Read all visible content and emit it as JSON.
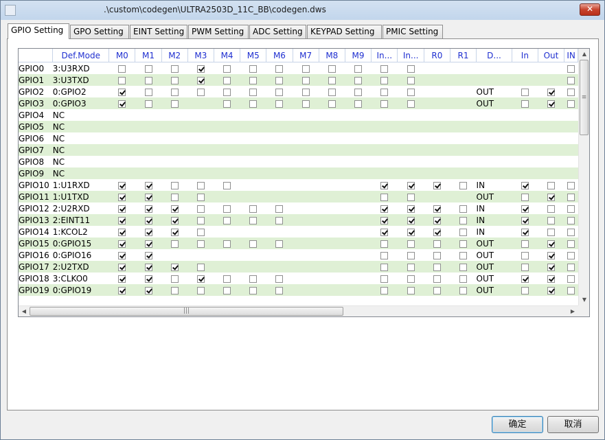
{
  "window": {
    "title": ".\\custom\\codegen\\ULTRA2503D_11C_BB\\codegen.dws",
    "close_glyph": "✕"
  },
  "tabs": [
    {
      "label": "GPIO Setting",
      "active": true
    },
    {
      "label": "GPO Setting"
    },
    {
      "label": "EINT Setting"
    },
    {
      "label": "PWM Setting"
    },
    {
      "label": "ADC Setting"
    },
    {
      "label": "KEYPAD Setting"
    },
    {
      "label": "PMIC Setting"
    }
  ],
  "grid": {
    "columns": [
      "",
      "Def.Mode",
      "M0",
      "M1",
      "M2",
      "M3",
      "M4",
      "M5",
      "M6",
      "M7",
      "M8",
      "M9",
      "In...",
      "In...",
      "R0",
      "R1",
      "D...",
      "In",
      "Out",
      "IN"
    ],
    "rows": [
      {
        "name": "GPIO0",
        "mode": "3:U3RXD",
        "m": [
          0,
          0,
          0,
          1,
          0,
          0,
          0,
          0,
          0,
          0
        ],
        "in1": 0,
        "in2": 0,
        "r0": null,
        "r1": null,
        "dir": "",
        "inv": null,
        "out": null,
        "ink": 0
      },
      {
        "name": "GPIO1",
        "mode": "3:U3TXD",
        "m": [
          0,
          0,
          0,
          1,
          0,
          0,
          0,
          0,
          0,
          0
        ],
        "in1": 0,
        "in2": 0,
        "r0": null,
        "r1": null,
        "dir": "",
        "inv": null,
        "out": null,
        "ink": 0
      },
      {
        "name": "GPIO2",
        "mode": "0:GPIO2",
        "m": [
          1,
          0,
          0,
          0,
          0,
          0,
          0,
          0,
          0,
          0
        ],
        "in1": 0,
        "in2": 0,
        "r0": null,
        "r1": null,
        "dir": "OUT",
        "inv": 0,
        "out": 1,
        "ink": 0
      },
      {
        "name": "GPIO3",
        "mode": "0:GPIO3",
        "m": [
          1,
          0,
          0,
          null,
          0,
          0,
          0,
          0,
          0,
          0
        ],
        "in1": 0,
        "in2": 0,
        "r0": null,
        "r1": null,
        "dir": "OUT",
        "inv": 0,
        "out": 1,
        "ink": 0
      },
      {
        "name": "GPIO4",
        "mode": "NC",
        "m": [
          null,
          null,
          null,
          null,
          null,
          null,
          null,
          null,
          null,
          null
        ],
        "in1": null,
        "in2": null,
        "r0": null,
        "r1": null,
        "dir": "",
        "inv": null,
        "out": null,
        "ink": null
      },
      {
        "name": "GPIO5",
        "mode": "NC",
        "m": [
          null,
          null,
          null,
          null,
          null,
          null,
          null,
          null,
          null,
          null
        ],
        "in1": null,
        "in2": null,
        "r0": null,
        "r1": null,
        "dir": "",
        "inv": null,
        "out": null,
        "ink": null
      },
      {
        "name": "GPIO6",
        "mode": "NC",
        "m": [
          null,
          null,
          null,
          null,
          null,
          null,
          null,
          null,
          null,
          null
        ],
        "in1": null,
        "in2": null,
        "r0": null,
        "r1": null,
        "dir": "",
        "inv": null,
        "out": null,
        "ink": null
      },
      {
        "name": "GPIO7",
        "mode": "NC",
        "m": [
          null,
          null,
          null,
          null,
          null,
          null,
          null,
          null,
          null,
          null
        ],
        "in1": null,
        "in2": null,
        "r0": null,
        "r1": null,
        "dir": "",
        "inv": null,
        "out": null,
        "ink": null
      },
      {
        "name": "GPIO8",
        "mode": "NC",
        "m": [
          null,
          null,
          null,
          null,
          null,
          null,
          null,
          null,
          null,
          null
        ],
        "in1": null,
        "in2": null,
        "r0": null,
        "r1": null,
        "dir": "",
        "inv": null,
        "out": null,
        "ink": null
      },
      {
        "name": "GPIO9",
        "mode": "NC",
        "m": [
          null,
          null,
          null,
          null,
          null,
          null,
          null,
          null,
          null,
          null
        ],
        "in1": null,
        "in2": null,
        "r0": null,
        "r1": null,
        "dir": "",
        "inv": null,
        "out": null,
        "ink": null
      },
      {
        "name": "GPIO10",
        "mode": "1:U1RXD",
        "m": [
          1,
          1,
          0,
          0,
          0,
          null,
          null,
          null,
          null,
          null
        ],
        "in1": 1,
        "in2": 1,
        "r0": 1,
        "r1": 0,
        "dir": "IN",
        "inv": 1,
        "out": 0,
        "ink": 0
      },
      {
        "name": "GPIO11",
        "mode": "1:U1TXD",
        "m": [
          1,
          1,
          0,
          0,
          null,
          null,
          null,
          null,
          null,
          null
        ],
        "in1": 0,
        "in2": 0,
        "r0": null,
        "r1": null,
        "dir": "OUT",
        "inv": 0,
        "out": 1,
        "ink": 0
      },
      {
        "name": "GPIO12",
        "mode": "2:U2RXD",
        "m": [
          1,
          1,
          1,
          0,
          0,
          0,
          0,
          null,
          null,
          null
        ],
        "in1": 1,
        "in2": 1,
        "r0": 1,
        "r1": 0,
        "dir": "IN",
        "inv": 1,
        "out": 0,
        "ink": 0
      },
      {
        "name": "GPIO13",
        "mode": "2:EINT11",
        "m": [
          1,
          1,
          1,
          0,
          0,
          0,
          0,
          null,
          null,
          null
        ],
        "in1": 1,
        "in2": 1,
        "r0": 1,
        "r1": 0,
        "dir": "IN",
        "inv": 1,
        "out": 0,
        "ink": 0
      },
      {
        "name": "GPIO14",
        "mode": "1:KCOL2",
        "m": [
          1,
          1,
          1,
          0,
          null,
          null,
          null,
          null,
          null,
          null
        ],
        "in1": 1,
        "in2": 1,
        "r0": 1,
        "r1": 0,
        "dir": "IN",
        "inv": 1,
        "out": 0,
        "ink": 0
      },
      {
        "name": "GPIO15",
        "mode": "0:GPIO15",
        "m": [
          1,
          1,
          0,
          0,
          0,
          0,
          0,
          null,
          null,
          null
        ],
        "in1": 0,
        "in2": 0,
        "r0": 0,
        "r1": 0,
        "dir": "OUT",
        "inv": 0,
        "out": 1,
        "ink": 0
      },
      {
        "name": "GPIO16",
        "mode": "0:GPIO16",
        "m": [
          1,
          1,
          null,
          null,
          null,
          null,
          null,
          null,
          null,
          null
        ],
        "in1": 0,
        "in2": 0,
        "r0": 0,
        "r1": 0,
        "dir": "OUT",
        "inv": 0,
        "out": 1,
        "ink": 0
      },
      {
        "name": "GPIO17",
        "mode": "2:U2TXD",
        "m": [
          1,
          1,
          1,
          0,
          null,
          null,
          null,
          null,
          null,
          null
        ],
        "in1": 0,
        "in2": 0,
        "r0": 0,
        "r1": 0,
        "dir": "OUT",
        "inv": 0,
        "out": 1,
        "ink": 0
      },
      {
        "name": "GPIO18",
        "mode": "3:CLKO0",
        "m": [
          1,
          1,
          0,
          1,
          0,
          0,
          0,
          null,
          null,
          null
        ],
        "in1": 0,
        "in2": 0,
        "r0": 0,
        "r1": 0,
        "dir": "OUT",
        "inv": 1,
        "out": 1,
        "ink": 0
      },
      {
        "name": "GPIO19",
        "mode": "0:GPIO19",
        "m": [
          1,
          1,
          0,
          0,
          0,
          0,
          0,
          null,
          null,
          null
        ],
        "in1": 0,
        "in2": 0,
        "r0": 0,
        "r1": 0,
        "dir": "OUT",
        "inv": 0,
        "out": 1,
        "ink": 0
      }
    ]
  },
  "scrollbar": {
    "up": "▲",
    "down": "▼",
    "left": "◀",
    "right": "▶",
    "grip_v": "≡",
    "grip_h": "|||"
  },
  "buttons": {
    "ok": "确定",
    "cancel": "取消"
  }
}
